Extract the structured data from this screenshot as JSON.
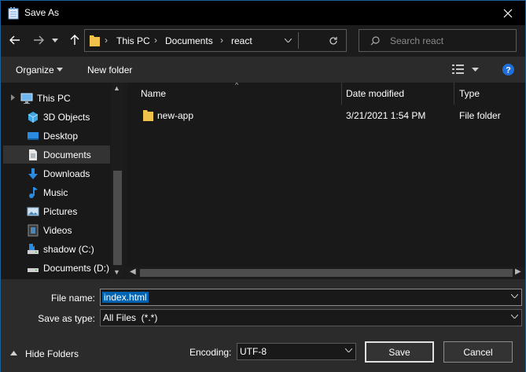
{
  "window": {
    "title": "Save As"
  },
  "nav": {
    "breadcrumbs": [
      "This PC",
      "Documents",
      "react"
    ],
    "search_placeholder": "Search react"
  },
  "toolbar": {
    "organize_label": "Organize",
    "new_folder_label": "New folder"
  },
  "tree": {
    "items": [
      {
        "label": "This PC",
        "icon": "computer-icon",
        "selected": false
      },
      {
        "label": "3D Objects",
        "icon": "cube-icon",
        "selected": false
      },
      {
        "label": "Desktop",
        "icon": "desktop-icon",
        "selected": false
      },
      {
        "label": "Documents",
        "icon": "document-icon",
        "selected": true
      },
      {
        "label": "Downloads",
        "icon": "download-arrow-icon",
        "selected": false
      },
      {
        "label": "Music",
        "icon": "music-note-icon",
        "selected": false
      },
      {
        "label": "Pictures",
        "icon": "picture-icon",
        "selected": false
      },
      {
        "label": "Videos",
        "icon": "film-icon",
        "selected": false
      },
      {
        "label": "shadow (C:)",
        "icon": "drive-icon",
        "selected": false
      },
      {
        "label": "Documents (D:)",
        "icon": "drive-icon",
        "selected": false
      }
    ]
  },
  "columns": {
    "name": "Name",
    "date": "Date modified",
    "type": "Type"
  },
  "files": [
    {
      "name": "new-app",
      "date": "3/21/2021 1:54 PM",
      "type": "File folder"
    }
  ],
  "form": {
    "filename_label": "File name:",
    "filename_value": "index.html",
    "savetype_label": "Save as type:",
    "savetype_value": "All Files  (*.*)",
    "encoding_label": "Encoding:",
    "encoding_value": "UTF-8",
    "hide_folders_label": "Hide Folders",
    "save_label": "Save",
    "cancel_label": "Cancel"
  },
  "colors": {
    "accent": "#0063b1",
    "folder": "#f0c24b",
    "help": "#1e6fd9"
  }
}
